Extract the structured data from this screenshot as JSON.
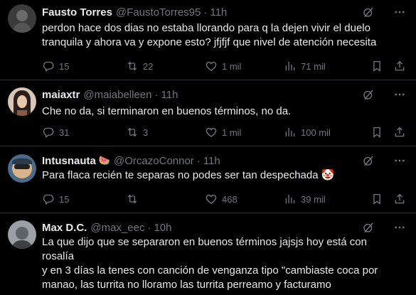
{
  "posts": [
    {
      "name": "Fausto Torres",
      "badge": "",
      "handle": "@FaustoTorres95",
      "dot": "·",
      "time": "11h",
      "text": "perdon hace dos dias no estaba llorando para q la dejen vivir el duelo\ntranquila y ahora va y expone esto? jfjfjf que nivel de atención necesita",
      "replies": "15",
      "reposts": "22",
      "likes": "1 mil",
      "views": "71 mil"
    },
    {
      "name": "maiaxtr",
      "badge": "",
      "handle": "@maiabelleen",
      "dot": "·",
      "time": "11h",
      "text": "Che no da, si terminaron en buenos términos, no da.",
      "replies": "31",
      "reposts": "3",
      "likes": "1 mil",
      "views": "100 mil"
    },
    {
      "name": "Intusnauta",
      "badge": "🍉",
      "handle": "@OrcazoConnor",
      "dot": "·",
      "time": "11h",
      "text": "Para flaca recién te separas no podes ser tan despechada 🤡",
      "replies": "15",
      "reposts": "",
      "likes": "468",
      "views": "39 mil"
    },
    {
      "name": "Max D.C.",
      "badge": "",
      "handle": "@max_eec",
      "dot": "·",
      "time": "10h",
      "text": "La que dijo que se separaron en buenos términos jajsjs hoy está con rosalía\ny en 3 días la tenes con canción de venganza tipo \"cambiaste coca por\nmanao, las turrita no lloramo las turrita perreamo y facturamo\nrroonnrroonn\""
    }
  ],
  "colors": {
    "background": "#000000",
    "text": "#e7e9ea",
    "muted": "#71767b",
    "divider": "#2f3336"
  },
  "icons": [
    "reply-icon",
    "repost-icon",
    "like-icon",
    "views-icon",
    "bookmark-icon",
    "share-icon",
    "grok-icon",
    "more-icon"
  ]
}
